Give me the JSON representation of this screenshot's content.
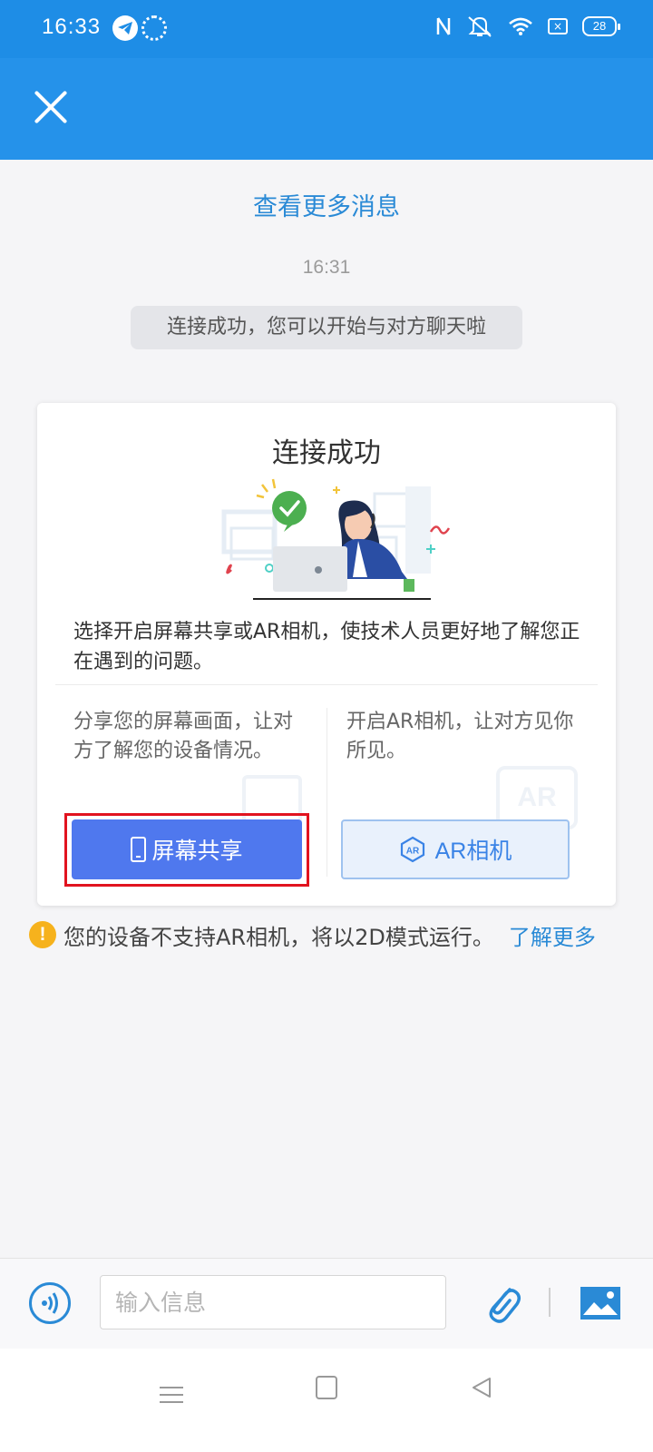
{
  "status_bar": {
    "time": "16:33",
    "battery": "28",
    "icons": [
      "telegram-icon",
      "app-icon",
      "nfc-icon",
      "mute-icon",
      "wifi-icon",
      "no-sim-icon",
      "battery-icon"
    ]
  },
  "header": {
    "close_icon": "close-icon"
  },
  "chat": {
    "more_link": "查看更多消息",
    "time": "16:31",
    "system_message": "连接成功，您可以开始与对方聊天啦"
  },
  "card": {
    "title": "连接成功",
    "description": "选择开启屏幕共享或AR相机，使技术人员更好地了解您正在遇到的问题。",
    "screen_share_desc": "分享您的屏幕画面，让对方了解您的设备情况。",
    "ar_desc": "开启AR相机，让对方见你所见。",
    "screen_share_button": "屏幕共享",
    "ar_button": "AR相机",
    "ar_badge": "AR"
  },
  "notice": {
    "text": "您的设备不支持AR相机，将以2D模式运行。",
    "link": "了解更多",
    "icon_mark": "!"
  },
  "input_bar": {
    "placeholder": "输入信息",
    "value": ""
  },
  "colors": {
    "brand_blue": "#2592ea",
    "primary_button": "#4f78ee",
    "link": "#2a8ad6",
    "highlight": "#e1131f",
    "warning": "#f6b21d"
  }
}
